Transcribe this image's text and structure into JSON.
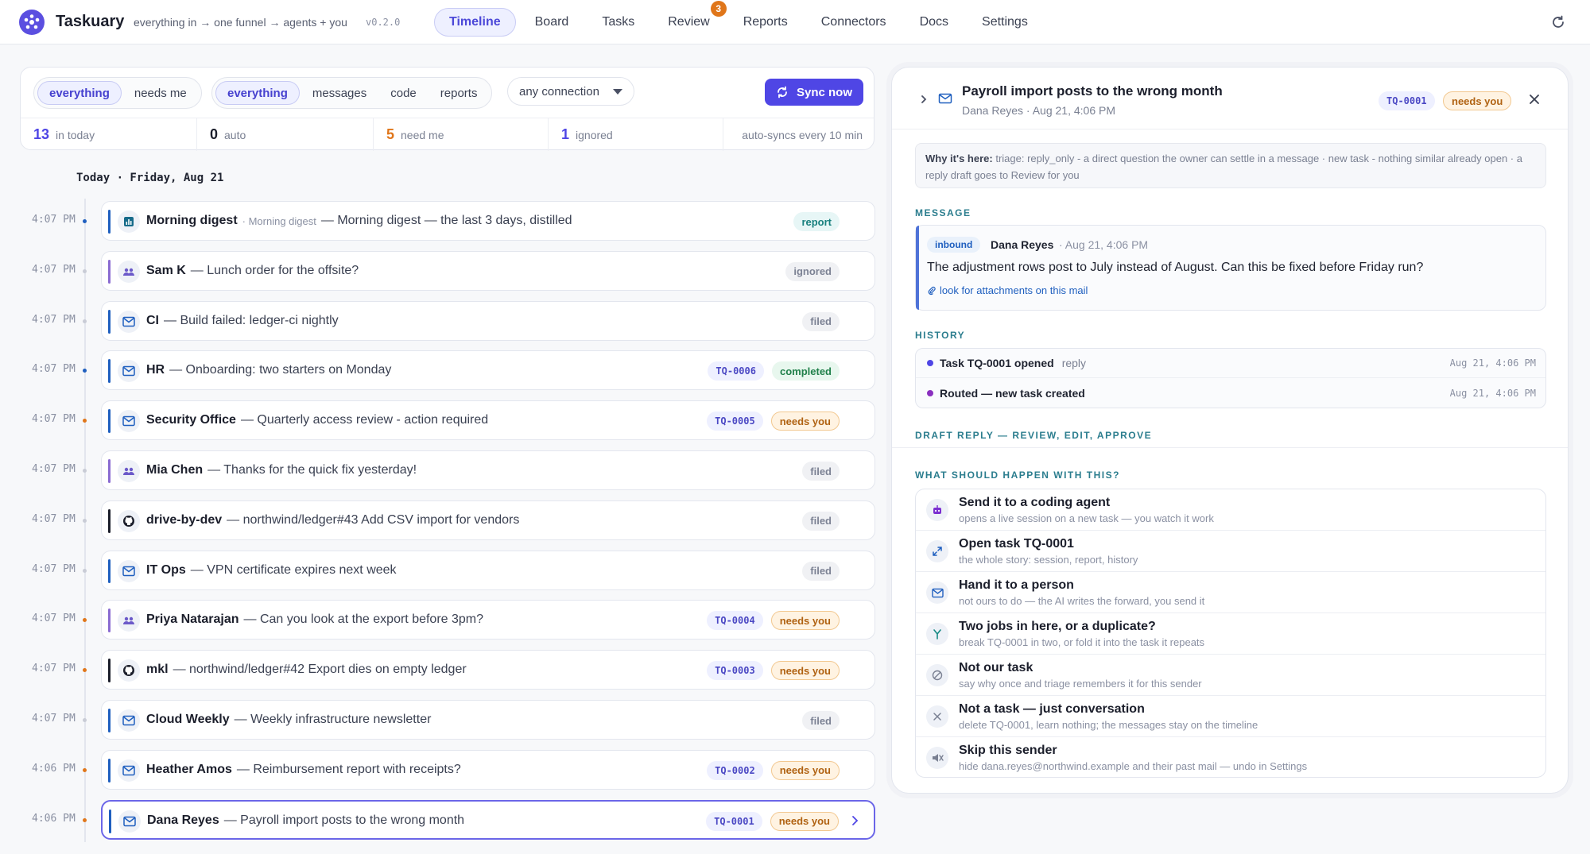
{
  "header": {
    "brand": "Taskuary",
    "tagline": "everything in → one funnel → agents + you",
    "version": "v0.2.0",
    "tabs": [
      {
        "label": "Timeline",
        "active": true
      },
      {
        "label": "Board"
      },
      {
        "label": "Tasks"
      },
      {
        "label": "Review",
        "badge": "3"
      },
      {
        "label": "Reports"
      },
      {
        "label": "Connectors"
      },
      {
        "label": "Docs"
      },
      {
        "label": "Settings"
      }
    ]
  },
  "filters": {
    "scope": [
      "everything",
      "needs me"
    ],
    "kind": [
      "everything",
      "messages",
      "code",
      "reports"
    ],
    "connection": "any connection",
    "sync_label": "Sync now",
    "stats": {
      "in_today": "13",
      "in_today_label": "in today",
      "auto": "0",
      "auto_label": "auto",
      "need_me": "5",
      "need_me_label": "need me",
      "ignored": "1",
      "ignored_label": "ignored",
      "autosync": "auto-syncs every 10 min"
    }
  },
  "timeline": {
    "day": "Today · Friday, Aug 21",
    "rows": [
      {
        "time": "4:07 PM",
        "who": "Morning digest",
        "via": "· Morning digest",
        "text": "— Morning digest — the last 3 days, distilled",
        "icon": "report",
        "status": "report"
      },
      {
        "time": "4:07 PM",
        "who": "Sam K",
        "text": "— Lunch order for the offsite?",
        "icon": "people",
        "status": "ignored"
      },
      {
        "time": "4:07 PM",
        "who": "CI",
        "text": "— Build failed: ledger-ci nightly",
        "icon": "mail",
        "status": "filed"
      },
      {
        "time": "4:07 PM",
        "who": "HR",
        "text": "— Onboarding: two starters on Monday",
        "icon": "mail",
        "task": "TQ-0006",
        "status": "completed"
      },
      {
        "time": "4:07 PM",
        "who": "Security Office",
        "text": "— Quarterly access review - action required",
        "icon": "mail",
        "task": "TQ-0005",
        "status": "needs you"
      },
      {
        "time": "4:07 PM",
        "who": "Mia Chen",
        "text": "— Thanks for the quick fix yesterday!",
        "icon": "people",
        "status": "filed"
      },
      {
        "time": "4:07 PM",
        "who": "drive-by-dev",
        "text": "— northwind/ledger#43 Add CSV import for vendors",
        "icon": "github",
        "status": "filed"
      },
      {
        "time": "4:07 PM",
        "who": "IT Ops",
        "text": "— VPN certificate expires next week",
        "icon": "mail",
        "status": "filed"
      },
      {
        "time": "4:07 PM",
        "who": "Priya Natarajan",
        "text": "— Can you look at the export before 3pm?",
        "icon": "people",
        "task": "TQ-0004",
        "status": "needs you"
      },
      {
        "time": "4:07 PM",
        "who": "mkl",
        "text": "— northwind/ledger#42 Export dies on empty ledger",
        "icon": "github",
        "task": "TQ-0003",
        "status": "needs you"
      },
      {
        "time": "4:07 PM",
        "who": "Cloud Weekly",
        "text": "— Weekly infrastructure newsletter",
        "icon": "mail",
        "status": "filed"
      },
      {
        "time": "4:06 PM",
        "who": "Heather Amos",
        "text": "— Reimbursement report with receipts?",
        "icon": "mail",
        "task": "TQ-0002",
        "status": "needs you"
      },
      {
        "time": "4:06 PM",
        "who": "Dana Reyes",
        "text": "— Payroll import posts to the wrong month",
        "icon": "mail",
        "task": "TQ-0001",
        "status": "needs you",
        "selected": true
      }
    ]
  },
  "detail": {
    "title": "Payroll import posts to the wrong month",
    "sub": "Dana Reyes · Aug 21, 4:06 PM",
    "task": "TQ-0001",
    "status": "needs you",
    "why_label": "Why it's here:",
    "why_text": "triage: reply_only - a direct question the owner can settle in a message · new task - nothing similar already open · a reply draft goes to Review for you",
    "message_section": "MESSAGE",
    "message": {
      "direction": "inbound",
      "from": "Dana Reyes",
      "ts": "· Aug 21, 4:06 PM",
      "body": "The adjustment rows post to July instead of August. Can this be fixed before Friday run?",
      "attach": "look for attachments on this mail"
    },
    "history_section": "HISTORY",
    "history": [
      {
        "title": "Task TQ-0001 opened",
        "sub": "reply",
        "ts": "Aug 21, 4:06 PM"
      },
      {
        "title": "Routed — new task created",
        "sub": "",
        "ts": "Aug 21, 4:06 PM"
      }
    ],
    "draft_section": "DRAFT REPLY — REVIEW, EDIT, APPROVE",
    "actions_section": "WHAT SHOULD HAPPEN WITH THIS?",
    "actions": [
      {
        "title": "Send it to a coding agent",
        "sub": "opens a live session on a new task — you watch it work",
        "icon": "robot"
      },
      {
        "title": "Open task TQ-0001",
        "sub": "the whole story: session, report, history",
        "icon": "expand"
      },
      {
        "title": "Hand it to a person",
        "sub": "not ours to do — the AI writes the forward, you send it",
        "icon": "mail"
      },
      {
        "title": "Two jobs in here, or a duplicate?",
        "sub": "break TQ-0001 in two, or fold it into the task it repeats",
        "icon": "split"
      },
      {
        "title": "Not our task",
        "sub": "say why once and triage remembers it for this sender",
        "icon": "block"
      },
      {
        "title": "Not a task — just conversation",
        "sub": "delete TQ-0001, learn nothing; the messages stay on the timeline",
        "icon": "x"
      },
      {
        "title": "Skip this sender",
        "sub": "hide dana.reyes@northwind.example and their past mail — undo in Settings",
        "icon": "mute"
      }
    ]
  },
  "colors": {
    "accent": "#4f46e5",
    "needs": "#e0761a",
    "mail_bar": "#1f5fbf",
    "people_bar": "#8a6bd1"
  }
}
